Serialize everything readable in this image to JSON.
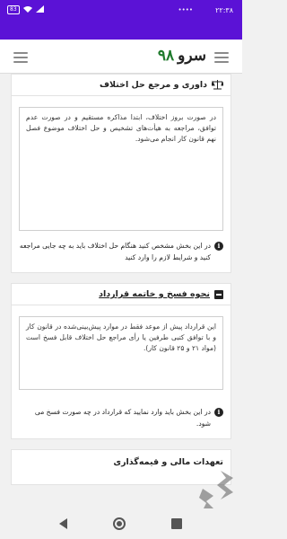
{
  "status_bar": {
    "time": "۲۲:۳۸",
    "battery": "83",
    "tray": "••••"
  },
  "app": {
    "brand_number": "۹۸",
    "brand_name": "سرو"
  },
  "cards": [
    {
      "title": "داوری و مرجع حل اختلاف",
      "body": "در صورت بروز اختلاف، ابتدا مذاکره مستقیم و در صورت عدم توافق، مراجعه به هیأت‌های تشخیص و حل اختلاف موضوع فصل نهم قانون کار انجام می‌شود.",
      "hint": "در این بخش مشخص کنید هنگام حل اختلاف باید به چه جایی مراجعه کنید و شرایط لازم را وارد کنید"
    },
    {
      "title": "نحوه فسخ و خاتمه قرارداد",
      "body": "این قرارداد پیش از موعد فقط در موارد پیش‌بینی‌شده در قانون کار و با توافق کتبی طرفین یا رأی مراجع حل اختلاف قابل فسخ است (مواد ۲۱ و ۲۵ قانون کار).",
      "hint": "در این بخش باید وارد نمایید که قرارداد در چه صورت فسخ می شود."
    }
  ],
  "peek_title": "تعهدات مالی و قیمه‌گذاری"
}
